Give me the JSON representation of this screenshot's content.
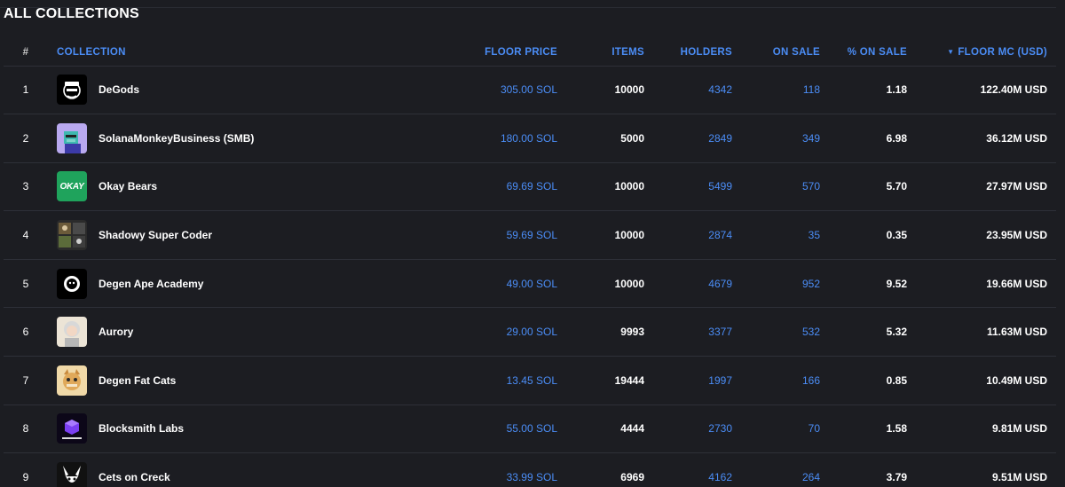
{
  "page_title": "ALL COLLECTIONS",
  "columns": {
    "rank": "#",
    "collection": "COLLECTION",
    "floor_price": "FLOOR PRICE",
    "items": "ITEMS",
    "holders": "HOLDERS",
    "on_sale": "ON SALE",
    "pct_on_sale": "% ON SALE",
    "floor_mc": "FLOOR MC (USD)",
    "floor_mc_sort_icon": "caret-down-icon"
  },
  "rows": [
    {
      "rank": "1",
      "name": "DeGods",
      "floor": "305.00 SOL",
      "items": "10000",
      "holders": "4342",
      "on_sale": "118",
      "pct": "1.18",
      "mc": "122.40M USD",
      "logo_icon": "degods-logo-icon",
      "logo_bg": "#000000"
    },
    {
      "rank": "2",
      "name": "SolanaMonkeyBusiness (SMB)",
      "floor": "180.00 SOL",
      "items": "5000",
      "holders": "2849",
      "on_sale": "349",
      "pct": "6.98",
      "mc": "36.12M USD",
      "logo_icon": "smb-logo-icon",
      "logo_bg": "#b9a9f0"
    },
    {
      "rank": "3",
      "name": "Okay Bears",
      "floor": "69.69 SOL",
      "items": "10000",
      "holders": "5499",
      "on_sale": "570",
      "pct": "5.70",
      "mc": "27.97M USD",
      "logo_icon": "okay-bears-logo-icon",
      "logo_bg": "#1fa35c",
      "logo_text": "OKAY"
    },
    {
      "rank": "4",
      "name": "Shadowy Super Coder",
      "floor": "59.69 SOL",
      "items": "10000",
      "holders": "2874",
      "on_sale": "35",
      "pct": "0.35",
      "mc": "23.95M USD",
      "logo_icon": "shadowy-super-coder-logo-icon",
      "logo_bg": "#2b2b2b"
    },
    {
      "rank": "5",
      "name": "Degen Ape Academy",
      "floor": "49.00 SOL",
      "items": "10000",
      "holders": "4679",
      "on_sale": "952",
      "pct": "9.52",
      "mc": "19.66M USD",
      "logo_icon": "degen-ape-academy-logo-icon",
      "logo_bg": "#000000"
    },
    {
      "rank": "6",
      "name": "Aurory",
      "floor": "29.00 SOL",
      "items": "9993",
      "holders": "3377",
      "on_sale": "532",
      "pct": "5.32",
      "mc": "11.63M USD",
      "logo_icon": "aurory-logo-icon",
      "logo_bg": "#ece4d6"
    },
    {
      "rank": "7",
      "name": "Degen Fat Cats",
      "floor": "13.45 SOL",
      "items": "19444",
      "holders": "1997",
      "on_sale": "166",
      "pct": "0.85",
      "mc": "10.49M USD",
      "logo_icon": "degen-fat-cats-logo-icon",
      "logo_bg": "#f0d9a8"
    },
    {
      "rank": "8",
      "name": "Blocksmith Labs",
      "floor": "55.00 SOL",
      "items": "4444",
      "holders": "2730",
      "on_sale": "70",
      "pct": "1.58",
      "mc": "9.81M USD",
      "logo_icon": "blocksmith-labs-logo-icon",
      "logo_bg": "#0c0718"
    },
    {
      "rank": "9",
      "name": "Cets on Creck",
      "floor": "33.99 SOL",
      "items": "6969",
      "holders": "4162",
      "on_sale": "264",
      "pct": "3.79",
      "mc": "9.51M USD",
      "logo_icon": "cets-on-creck-logo-icon",
      "logo_bg": "#111111"
    }
  ],
  "colors": {
    "accent": "#4b8df6",
    "background": "#1c1d22",
    "divider": "#2e3038"
  }
}
